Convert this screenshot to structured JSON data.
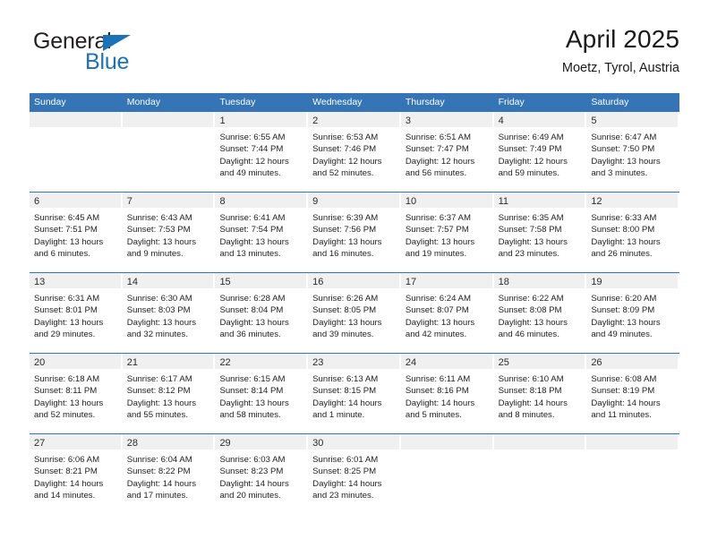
{
  "brand": {
    "word_top": "General",
    "word_bottom": "Blue",
    "triangle_icon": "blue-triangle-logo-mark",
    "color_dark": "#231f20",
    "color_blue": "#1a72b8"
  },
  "header": {
    "title": "April 2025",
    "subtitle": "Moetz, Tyrol, Austria"
  },
  "colors": {
    "header_blue": "#3575b5",
    "row_rule_blue": "#3575b5",
    "day_band_gray": "#f0f0f0",
    "text": "#1f1f1f"
  },
  "weekdays": [
    "Sunday",
    "Monday",
    "Tuesday",
    "Wednesday",
    "Thursday",
    "Friday",
    "Saturday"
  ],
  "weeks": [
    [
      {
        "day": "",
        "lines": []
      },
      {
        "day": "",
        "lines": []
      },
      {
        "day": "1",
        "lines": [
          "Sunrise: 6:55 AM",
          "Sunset: 7:44 PM",
          "Daylight: 12 hours",
          "and 49 minutes."
        ]
      },
      {
        "day": "2",
        "lines": [
          "Sunrise: 6:53 AM",
          "Sunset: 7:46 PM",
          "Daylight: 12 hours",
          "and 52 minutes."
        ]
      },
      {
        "day": "3",
        "lines": [
          "Sunrise: 6:51 AM",
          "Sunset: 7:47 PM",
          "Daylight: 12 hours",
          "and 56 minutes."
        ]
      },
      {
        "day": "4",
        "lines": [
          "Sunrise: 6:49 AM",
          "Sunset: 7:49 PM",
          "Daylight: 12 hours",
          "and 59 minutes."
        ]
      },
      {
        "day": "5",
        "lines": [
          "Sunrise: 6:47 AM",
          "Sunset: 7:50 PM",
          "Daylight: 13 hours",
          "and 3 minutes."
        ]
      }
    ],
    [
      {
        "day": "6",
        "lines": [
          "Sunrise: 6:45 AM",
          "Sunset: 7:51 PM",
          "Daylight: 13 hours",
          "and 6 minutes."
        ]
      },
      {
        "day": "7",
        "lines": [
          "Sunrise: 6:43 AM",
          "Sunset: 7:53 PM",
          "Daylight: 13 hours",
          "and 9 minutes."
        ]
      },
      {
        "day": "8",
        "lines": [
          "Sunrise: 6:41 AM",
          "Sunset: 7:54 PM",
          "Daylight: 13 hours",
          "and 13 minutes."
        ]
      },
      {
        "day": "9",
        "lines": [
          "Sunrise: 6:39 AM",
          "Sunset: 7:56 PM",
          "Daylight: 13 hours",
          "and 16 minutes."
        ]
      },
      {
        "day": "10",
        "lines": [
          "Sunrise: 6:37 AM",
          "Sunset: 7:57 PM",
          "Daylight: 13 hours",
          "and 19 minutes."
        ]
      },
      {
        "day": "11",
        "lines": [
          "Sunrise: 6:35 AM",
          "Sunset: 7:58 PM",
          "Daylight: 13 hours",
          "and 23 minutes."
        ]
      },
      {
        "day": "12",
        "lines": [
          "Sunrise: 6:33 AM",
          "Sunset: 8:00 PM",
          "Daylight: 13 hours",
          "and 26 minutes."
        ]
      }
    ],
    [
      {
        "day": "13",
        "lines": [
          "Sunrise: 6:31 AM",
          "Sunset: 8:01 PM",
          "Daylight: 13 hours",
          "and 29 minutes."
        ]
      },
      {
        "day": "14",
        "lines": [
          "Sunrise: 6:30 AM",
          "Sunset: 8:03 PM",
          "Daylight: 13 hours",
          "and 32 minutes."
        ]
      },
      {
        "day": "15",
        "lines": [
          "Sunrise: 6:28 AM",
          "Sunset: 8:04 PM",
          "Daylight: 13 hours",
          "and 36 minutes."
        ]
      },
      {
        "day": "16",
        "lines": [
          "Sunrise: 6:26 AM",
          "Sunset: 8:05 PM",
          "Daylight: 13 hours",
          "and 39 minutes."
        ]
      },
      {
        "day": "17",
        "lines": [
          "Sunrise: 6:24 AM",
          "Sunset: 8:07 PM",
          "Daylight: 13 hours",
          "and 42 minutes."
        ]
      },
      {
        "day": "18",
        "lines": [
          "Sunrise: 6:22 AM",
          "Sunset: 8:08 PM",
          "Daylight: 13 hours",
          "and 46 minutes."
        ]
      },
      {
        "day": "19",
        "lines": [
          "Sunrise: 6:20 AM",
          "Sunset: 8:09 PM",
          "Daylight: 13 hours",
          "and 49 minutes."
        ]
      }
    ],
    [
      {
        "day": "20",
        "lines": [
          "Sunrise: 6:18 AM",
          "Sunset: 8:11 PM",
          "Daylight: 13 hours",
          "and 52 minutes."
        ]
      },
      {
        "day": "21",
        "lines": [
          "Sunrise: 6:17 AM",
          "Sunset: 8:12 PM",
          "Daylight: 13 hours",
          "and 55 minutes."
        ]
      },
      {
        "day": "22",
        "lines": [
          "Sunrise: 6:15 AM",
          "Sunset: 8:14 PM",
          "Daylight: 13 hours",
          "and 58 minutes."
        ]
      },
      {
        "day": "23",
        "lines": [
          "Sunrise: 6:13 AM",
          "Sunset: 8:15 PM",
          "Daylight: 14 hours",
          "and 1 minute."
        ]
      },
      {
        "day": "24",
        "lines": [
          "Sunrise: 6:11 AM",
          "Sunset: 8:16 PM",
          "Daylight: 14 hours",
          "and 5 minutes."
        ]
      },
      {
        "day": "25",
        "lines": [
          "Sunrise: 6:10 AM",
          "Sunset: 8:18 PM",
          "Daylight: 14 hours",
          "and 8 minutes."
        ]
      },
      {
        "day": "26",
        "lines": [
          "Sunrise: 6:08 AM",
          "Sunset: 8:19 PM",
          "Daylight: 14 hours",
          "and 11 minutes."
        ]
      }
    ],
    [
      {
        "day": "27",
        "lines": [
          "Sunrise: 6:06 AM",
          "Sunset: 8:21 PM",
          "Daylight: 14 hours",
          "and 14 minutes."
        ]
      },
      {
        "day": "28",
        "lines": [
          "Sunrise: 6:04 AM",
          "Sunset: 8:22 PM",
          "Daylight: 14 hours",
          "and 17 minutes."
        ]
      },
      {
        "day": "29",
        "lines": [
          "Sunrise: 6:03 AM",
          "Sunset: 8:23 PM",
          "Daylight: 14 hours",
          "and 20 minutes."
        ]
      },
      {
        "day": "30",
        "lines": [
          "Sunrise: 6:01 AM",
          "Sunset: 8:25 PM",
          "Daylight: 14 hours",
          "and 23 minutes."
        ]
      },
      {
        "day": "",
        "lines": []
      },
      {
        "day": "",
        "lines": []
      },
      {
        "day": "",
        "lines": []
      }
    ]
  ]
}
